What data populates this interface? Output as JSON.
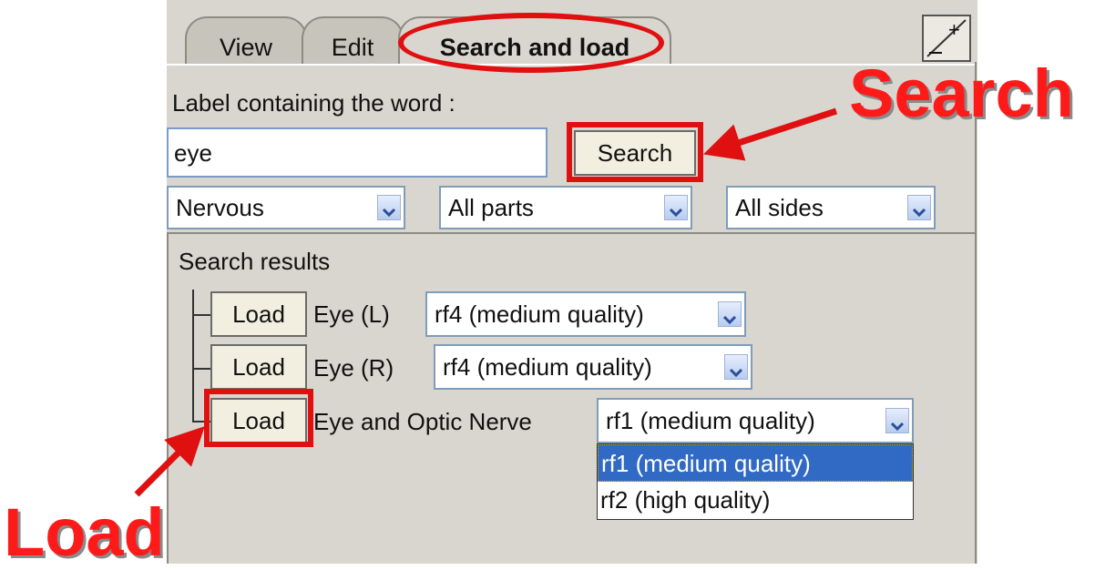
{
  "tabs": [
    {
      "label": "View"
    },
    {
      "label": "Edit"
    },
    {
      "label": "Search and load",
      "active": true
    }
  ],
  "search": {
    "label": "Label containing the word :",
    "value": "eye",
    "button": "Search"
  },
  "filters": [
    {
      "value": "Nervous"
    },
    {
      "value": "All parts"
    },
    {
      "value": "All sides"
    }
  ],
  "results": {
    "title": "Search results",
    "rows": [
      {
        "button": "Load",
        "name": "Eye (L)",
        "quality": "rf4 (medium quality)"
      },
      {
        "button": "Load",
        "name": "Eye (R)",
        "quality": "rf4 (medium quality)"
      },
      {
        "button": "Load",
        "name": "Eye and Optic Nerve",
        "quality": "rf1 (medium quality)"
      }
    ],
    "dropdown_options": [
      "rf1 (medium quality)",
      "rf2 (high quality)"
    ]
  },
  "window_controls": {
    "maximize": "+"
  },
  "annotations": {
    "search": "Search",
    "load": "Load",
    "color": "#e01010"
  }
}
